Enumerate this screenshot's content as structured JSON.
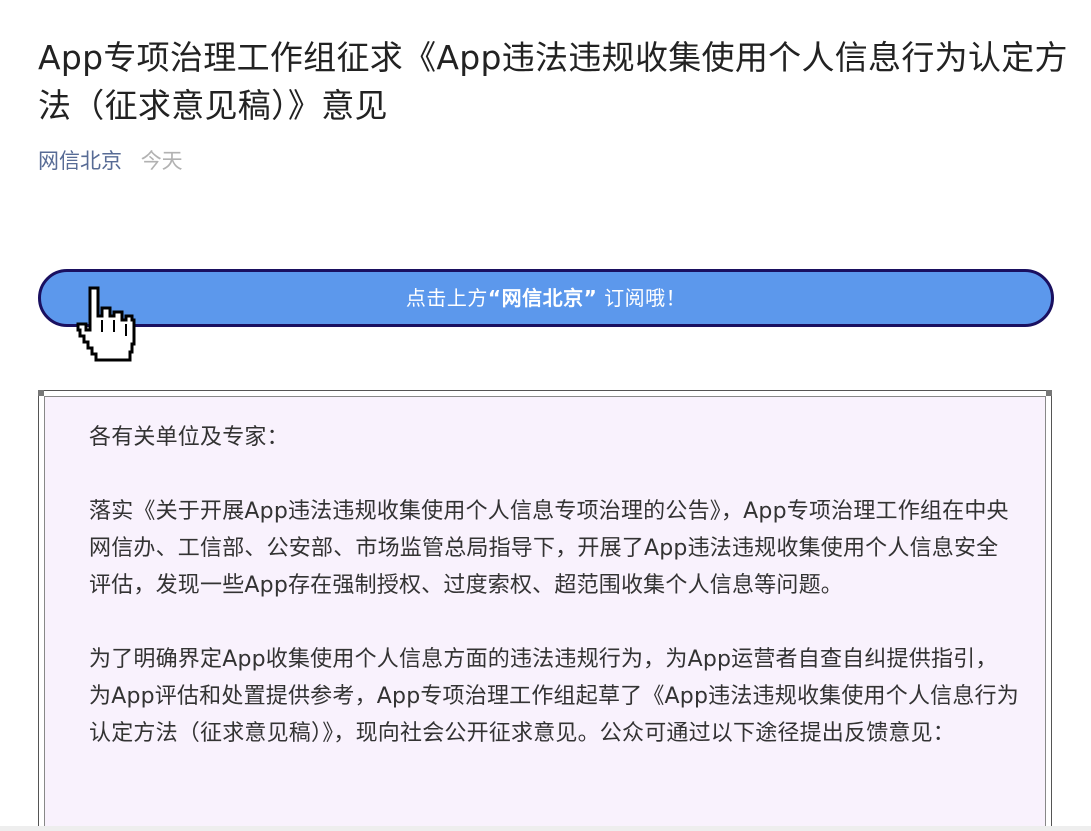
{
  "article": {
    "title": "App专项治理工作组征求《App违法违规收集使用个人信息行为认定方法（征求意见稿）》意见",
    "account_name": "网信北京",
    "date": "今天"
  },
  "banner": {
    "text_before": "点击上方",
    "text_strong": "“网信北京”",
    "text_after": " 订阅哦！",
    "bg_color": "#5c98ec",
    "border_color": "#1a1060"
  },
  "content": {
    "greeting": "各有关单位及专家：",
    "paragraph1": "落实《关于开展App违法违规收集使用个人信息专项治理的公告》，App专项治理工作组在中央网信办、工信部、公安部、市场监管总局指导下，开展了App违法违规收集使用个人信息安全评估，发现一些App存在强制授权、过度索权、超范围收集个人信息等问题。",
    "paragraph2": "为了明确界定App收集使用个人信息方面的违法违规行为，为App运营者自查自纠提供指引，为App评估和处置提供参考，App专项治理工作组起草了《App违法违规收集使用个人信息行为认定方法（征求意见稿）》，现向社会公开征求意见。公众可通过以下途径提出反馈意见：",
    "bg_color": "#f9f2fd"
  },
  "icons": {
    "cursor": "hand-pointer-icon"
  }
}
